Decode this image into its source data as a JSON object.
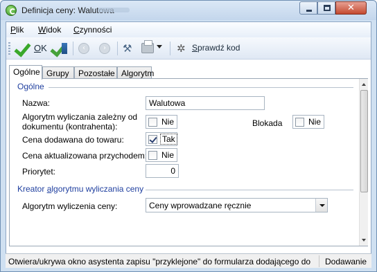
{
  "window": {
    "title": "Definicja ceny: Walutowa",
    "controls": {
      "minimize": "min",
      "maximize": "max",
      "close": "✕"
    }
  },
  "menu": [
    {
      "label": "Plik",
      "accel": "P",
      "rest": "lik"
    },
    {
      "label": "Widok",
      "accel": "W",
      "rest": "idok"
    },
    {
      "label": "Czynności",
      "accel": "C",
      "rest": "zynności"
    }
  ],
  "toolbar": {
    "ok_accel": "O",
    "ok_rest": "K",
    "sprawdz_accel": "S",
    "sprawdz_rest": "prawdź kod",
    "icons": [
      "check-icon",
      "save-close-icon",
      "back-icon",
      "forward-icon",
      "tools-icon",
      "print-icon",
      "magic-wand-icon"
    ]
  },
  "tabs": [
    "Ogólne",
    "Grupy",
    "Pozostałe",
    "Algorytm"
  ],
  "active_tab": "Ogólne",
  "general": {
    "section_title": "Ogólne",
    "name_label": "Nazwa:",
    "name_value": "Walutowa",
    "algorithm_label_1": "Algorytm wyliczania zależny od",
    "algorithm_label_2": "dokumentu (kontrahenta):",
    "algorithm_dependent": {
      "text": "Nie",
      "checked": false
    },
    "blokada_label": "Blokada",
    "blokada": {
      "text": "Nie",
      "checked": false
    },
    "added_to_goods_label": "Cena dodawana do towaru:",
    "added_to_goods": {
      "text": "Tak",
      "checked": true
    },
    "updated_by_income_label": "Cena aktualizowana przychodem:",
    "updated_by_income": {
      "text": "Nie",
      "checked": false
    },
    "priority_label": "Priorytet:",
    "priority_value": "0"
  },
  "wizard": {
    "section_title_pre": "Kreator ",
    "section_title_accel": "a",
    "section_title_post": "lgorytmu wyliczania ceny",
    "algorithm_label": "Algorytm wyliczenia ceny:",
    "algorithm_value": "Ceny wprowadzane ręcznie"
  },
  "status": {
    "hint": "Otwiera/ukrywa okno asystenta zapisu \"przyklejone\" do formularza dodającego do",
    "mode": "Dodawanie"
  }
}
